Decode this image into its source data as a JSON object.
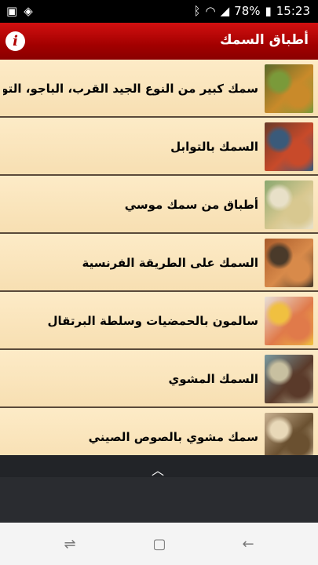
{
  "status": {
    "time": "15:23",
    "battery": "78%"
  },
  "app": {
    "title": "أطباق السمك",
    "info_label": "i"
  },
  "recipes": [
    {
      "title": "سمك كبير من النوع الجيد القرب، الباجو، التو",
      "colors": [
        "#5a6a2a",
        "#c98a2a",
        "#7a9a3a"
      ]
    },
    {
      "title": "السمك بالتوابل",
      "colors": [
        "#6a3a2a",
        "#c84a2a",
        "#3a5a7a"
      ]
    },
    {
      "title": "أطباق من سمك موسي",
      "colors": [
        "#8aa870",
        "#d8c890",
        "#e8e0c8"
      ]
    },
    {
      "title": "السمك على الطريقة الفرنسية",
      "colors": [
        "#a85a2a",
        "#d88a4a",
        "#4a3a2a"
      ]
    },
    {
      "title": "سالمون بالحمضيات وسلطة البرتقال",
      "colors": [
        "#e8e0d8",
        "#e07a4a",
        "#f0c040"
      ]
    },
    {
      "title": "السمك المشوي",
      "colors": [
        "#7a9aa0",
        "#5a3a2a",
        "#c8c0a0"
      ]
    },
    {
      "title": "سمك مشوي بالصوص الصيني",
      "colors": [
        "#c8b090",
        "#6a5030",
        "#e8d8b8"
      ]
    }
  ]
}
